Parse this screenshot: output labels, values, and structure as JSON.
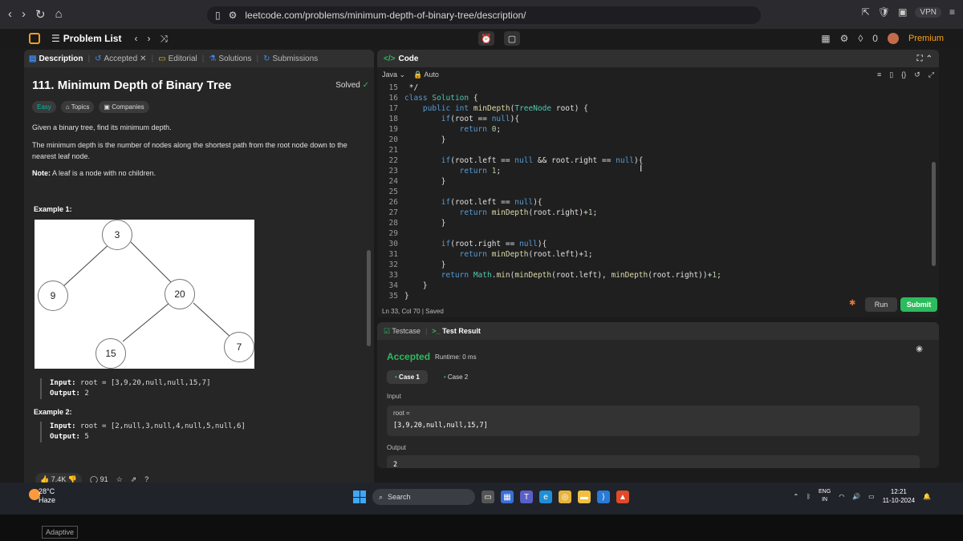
{
  "browser": {
    "url": "leetcode.com/problems/minimum-depth-of-binary-tree/description/",
    "vpn": "VPN"
  },
  "header": {
    "problem_list": "Problem List",
    "premium": "Premium",
    "points": "0"
  },
  "tabs": [
    {
      "label": "Description"
    },
    {
      "label": "Accepted"
    },
    {
      "label": "Editorial"
    },
    {
      "label": "Solutions"
    },
    {
      "label": "Submissions"
    }
  ],
  "problem": {
    "title": "111. Minimum Depth of Binary Tree",
    "status": "Solved",
    "difficulty": "Easy",
    "topics": "Topics",
    "companies": "Companies",
    "desc1": "Given a binary tree, find its minimum depth.",
    "desc2": "The minimum depth is the number of nodes along the shortest path from the root node down to the nearest leaf node.",
    "note_label": "Note:",
    "note_text": " A leaf is a node with no children.",
    "example1_title": "Example 1:",
    "example2_title": "Example 2:",
    "tree_nodes": [
      "3",
      "9",
      "20",
      "15",
      "7"
    ],
    "example1_input_label": "Input:",
    "example1_input": "root = [3,9,20,null,null,15,7]",
    "example1_output_label": "Output:",
    "example1_output": "2",
    "example2_input_label": "Input:",
    "example2_input": "root = [2,null,3,null,4,null,5,null,6]",
    "example2_output_label": "Output:",
    "example2_output": "5"
  },
  "footer": {
    "likes": "7.4K",
    "comments": "91"
  },
  "code_panel": {
    "title": "Code",
    "language": "Java",
    "mode": "Auto",
    "status": "Ln 33, Col 70",
    "saved": "Saved",
    "run": "Run",
    "submit": "Submit"
  },
  "code_lines": [
    {
      "n": "15",
      "t": " */"
    },
    {
      "n": "16",
      "t": "class Solution {"
    },
    {
      "n": "17",
      "t": "    public int minDepth(TreeNode root) {"
    },
    {
      "n": "18",
      "t": "        if(root == null){"
    },
    {
      "n": "19",
      "t": "            return 0;"
    },
    {
      "n": "20",
      "t": "        }"
    },
    {
      "n": "21",
      "t": ""
    },
    {
      "n": "22",
      "t": "        if(root.left == null && root.right == null){"
    },
    {
      "n": "23",
      "t": "            return 1;"
    },
    {
      "n": "24",
      "t": "        }"
    },
    {
      "n": "25",
      "t": ""
    },
    {
      "n": "26",
      "t": "        if(root.left == null){"
    },
    {
      "n": "27",
      "t": "            return minDepth(root.right)+1;"
    },
    {
      "n": "28",
      "t": "        }"
    },
    {
      "n": "29",
      "t": ""
    },
    {
      "n": "30",
      "t": "        if(root.right == null){"
    },
    {
      "n": "31",
      "t": "            return minDepth(root.left)+1;"
    },
    {
      "n": "32",
      "t": "        }"
    },
    {
      "n": "33",
      "t": "        return Math.min(minDepth(root.left), minDepth(root.right))+1;"
    },
    {
      "n": "34",
      "t": "    }"
    },
    {
      "n": "35",
      "t": "}"
    }
  ],
  "result": {
    "testcase_tab": "Testcase",
    "result_tab": "Test Result",
    "verdict": "Accepted",
    "runtime": "Runtime: 0 ms",
    "case1": "Case 1",
    "case2": "Case 2",
    "input_label": "Input",
    "input_var": "root =",
    "input_value": "[3,9,20,null,null,15,7]",
    "output_label": "Output",
    "output_value": "2"
  },
  "taskbar": {
    "temp": "28°C",
    "weather": "Haze",
    "search": "Search",
    "lang1": "ENG",
    "lang2": "IN",
    "time": "12:21",
    "date": "11-10-2024"
  },
  "bezel_label": "Adaptive"
}
